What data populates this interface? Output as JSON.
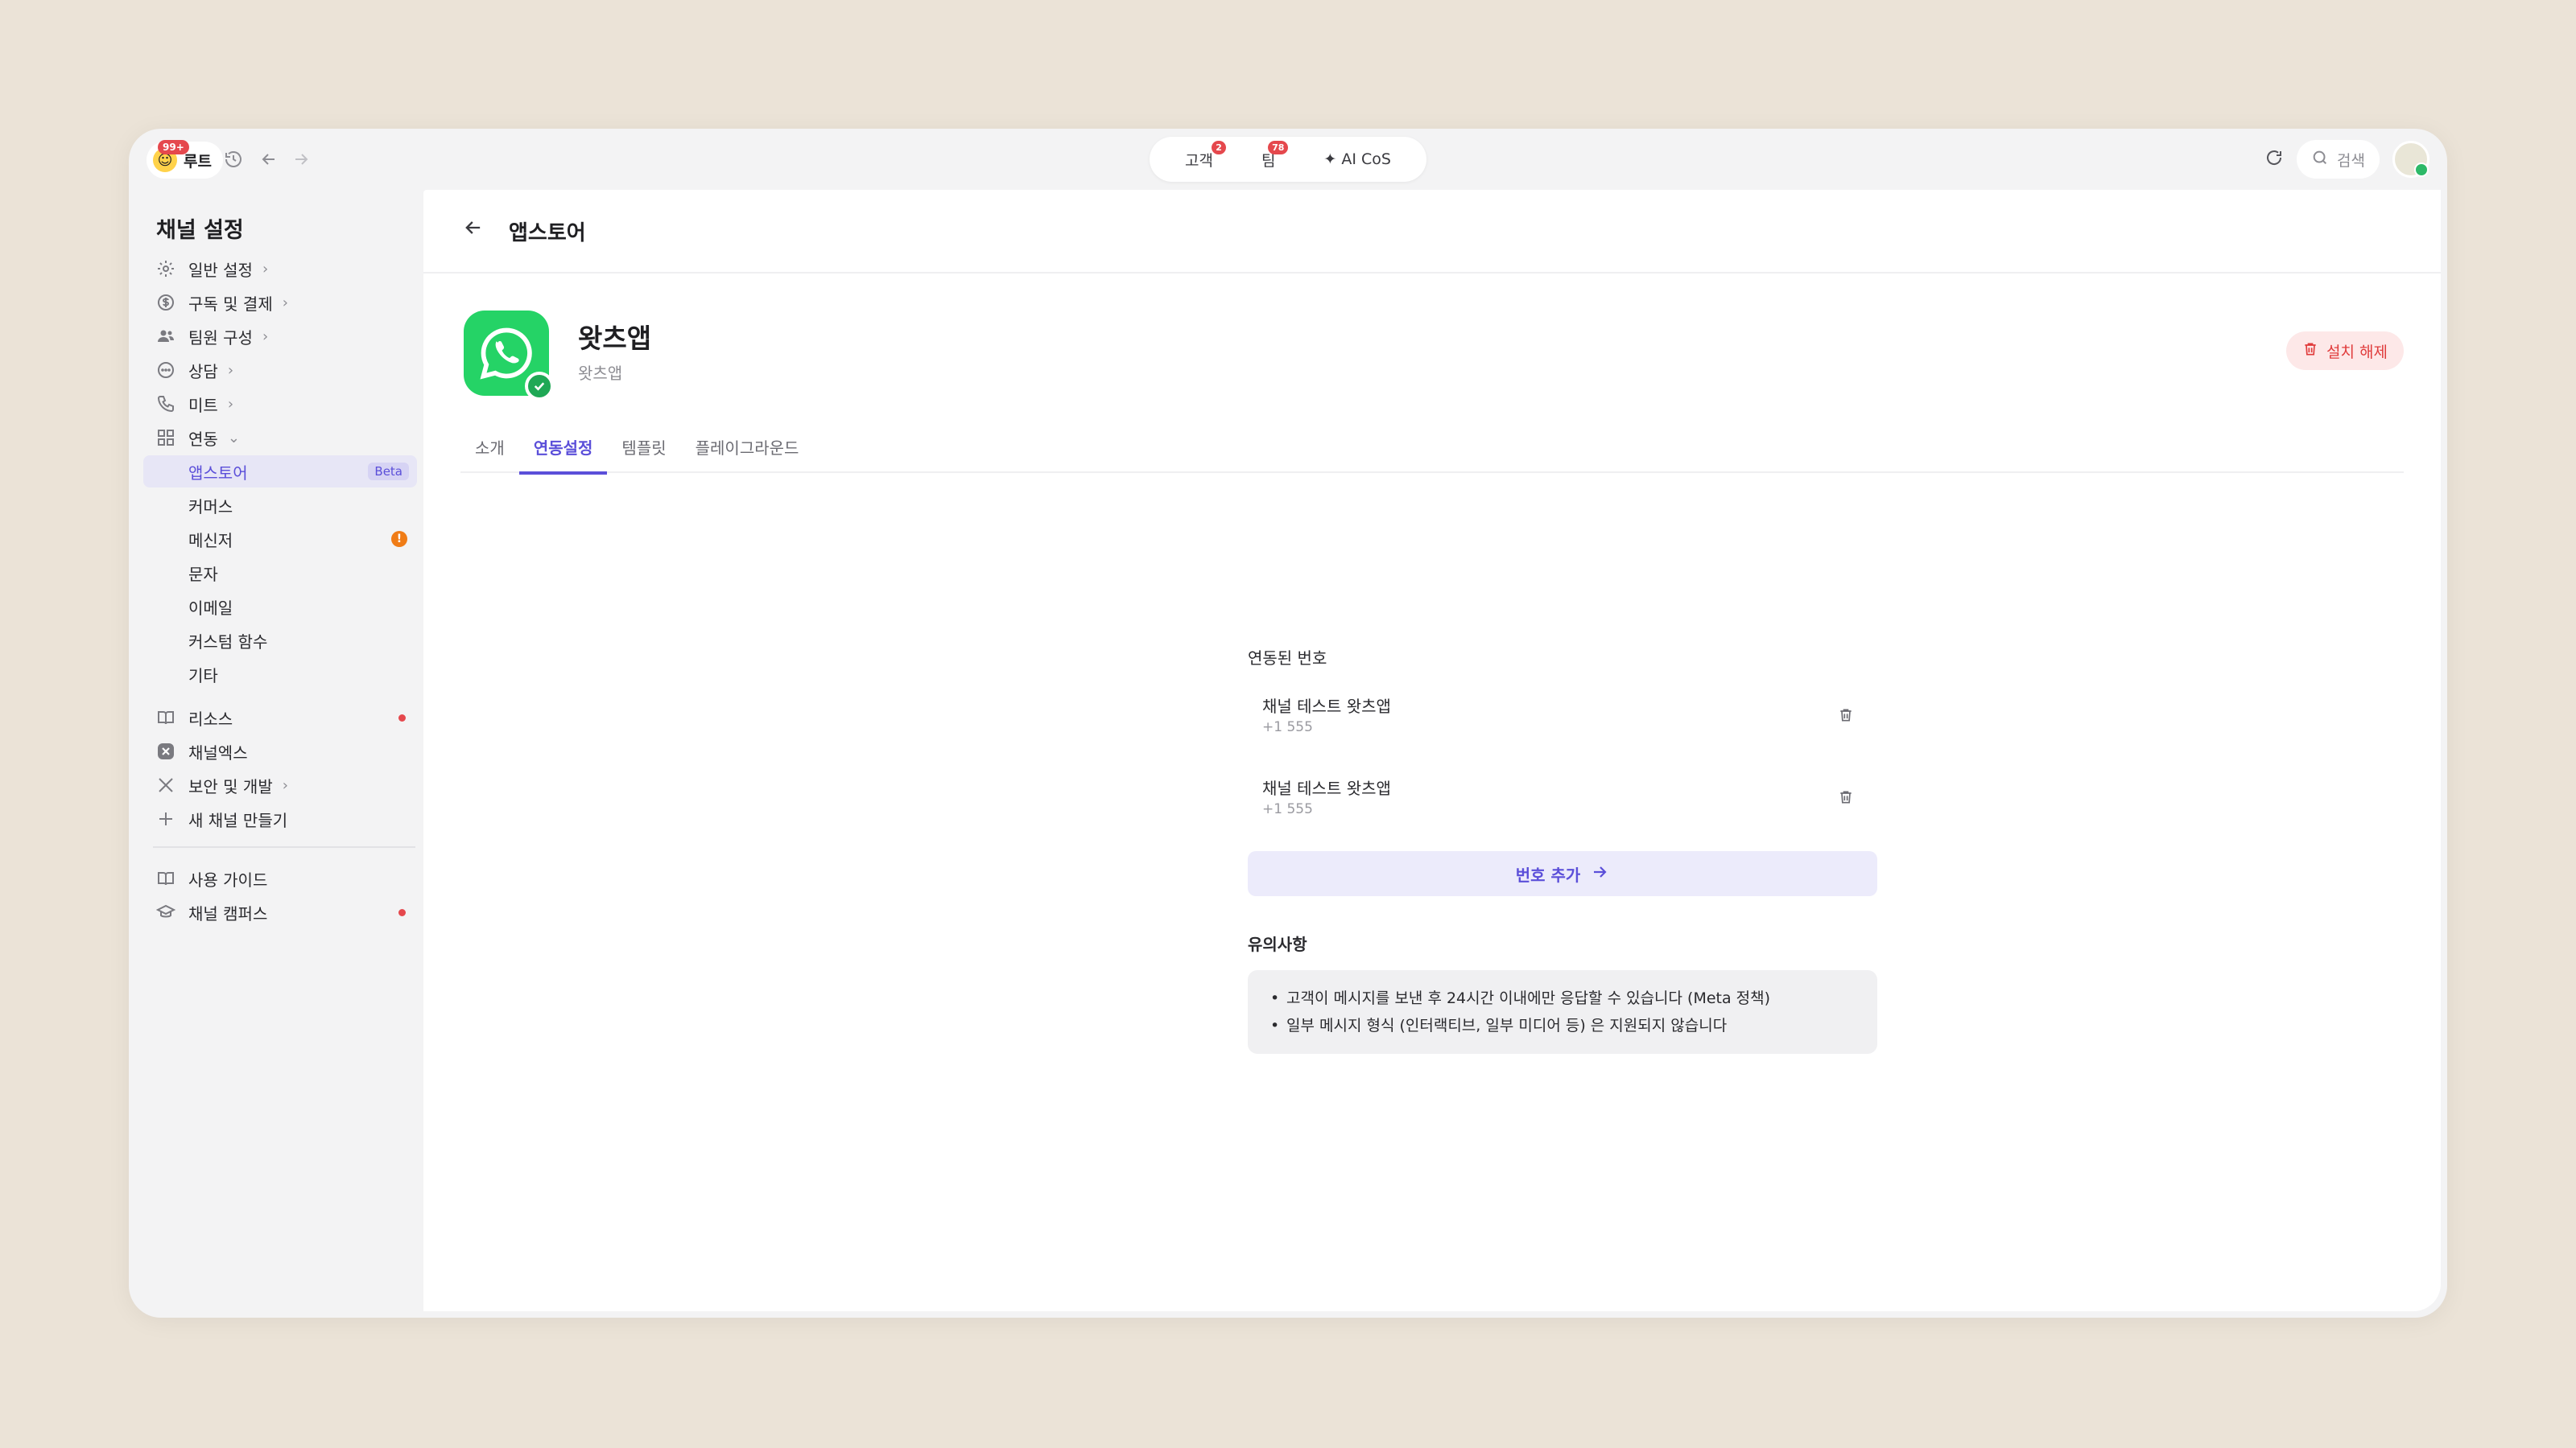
{
  "topbar": {
    "workspace_name": "루트",
    "workspace_badge": "99+",
    "tabs": [
      {
        "label": "고객",
        "badge": "2"
      },
      {
        "label": "팀",
        "badge": "78"
      },
      {
        "label": "✦ AI CoS",
        "badge": ""
      }
    ],
    "search_label": "검색"
  },
  "sidebar": {
    "title": "채널 설정",
    "items": [
      {
        "label": "일반 설정",
        "icon": "gear-icon"
      },
      {
        "label": "구독 및 결제",
        "icon": "dollar-icon"
      },
      {
        "label": "팀원 구성",
        "icon": "people-icon"
      },
      {
        "label": "상담",
        "icon": "chat-icon"
      },
      {
        "label": "미트",
        "icon": "phone-icon"
      },
      {
        "label": "연동",
        "icon": "grid-icon"
      }
    ],
    "sub_items": [
      {
        "label": "앱스토어",
        "tag": "Beta"
      },
      {
        "label": "커머스"
      },
      {
        "label": "메신저",
        "alert": "!"
      },
      {
        "label": "문자"
      },
      {
        "label": "이메일"
      },
      {
        "label": "커스텀 함수"
      },
      {
        "label": "기타"
      }
    ],
    "lower_items": [
      {
        "label": "리소스"
      },
      {
        "label": "채널엑스"
      },
      {
        "label": "보안 및 개발"
      },
      {
        "label": "새 채널 만들기"
      }
    ],
    "footer_items": [
      {
        "label": "사용 가이드"
      },
      {
        "label": "채널 캠퍼스"
      }
    ]
  },
  "main": {
    "title": "앱스토어",
    "app_name": "왓츠앱",
    "app_subtitle": "왓츠앱",
    "uninstall_label": "설치 해제",
    "tabs": [
      "소개",
      "연동설정",
      "템플릿",
      "플레이그라운드"
    ],
    "active_tab": "연동설정",
    "linked_title": "연동된 번호",
    "numbers": [
      {
        "name": "채널 테스트 왓츠앱",
        "phone": "+1 555"
      },
      {
        "name": "채널 테스트 왓츠앱",
        "phone": "+1 555"
      }
    ],
    "add_number_label": "번호 추가",
    "notice_title": "유의사항",
    "notices": [
      "고객이 메시지를 보낸 후 24시간 이내에만 응답할 수 있습니다 (Meta 정책)",
      "일부 메시지 형식 (인터랙티브, 일부 미디어 등) 은 지원되지 않습니다"
    ]
  },
  "colors": {
    "accent": "#5b4fd9",
    "whatsapp": "#25d366",
    "danger": "#e03b3b",
    "background": "#ebe3d7"
  }
}
